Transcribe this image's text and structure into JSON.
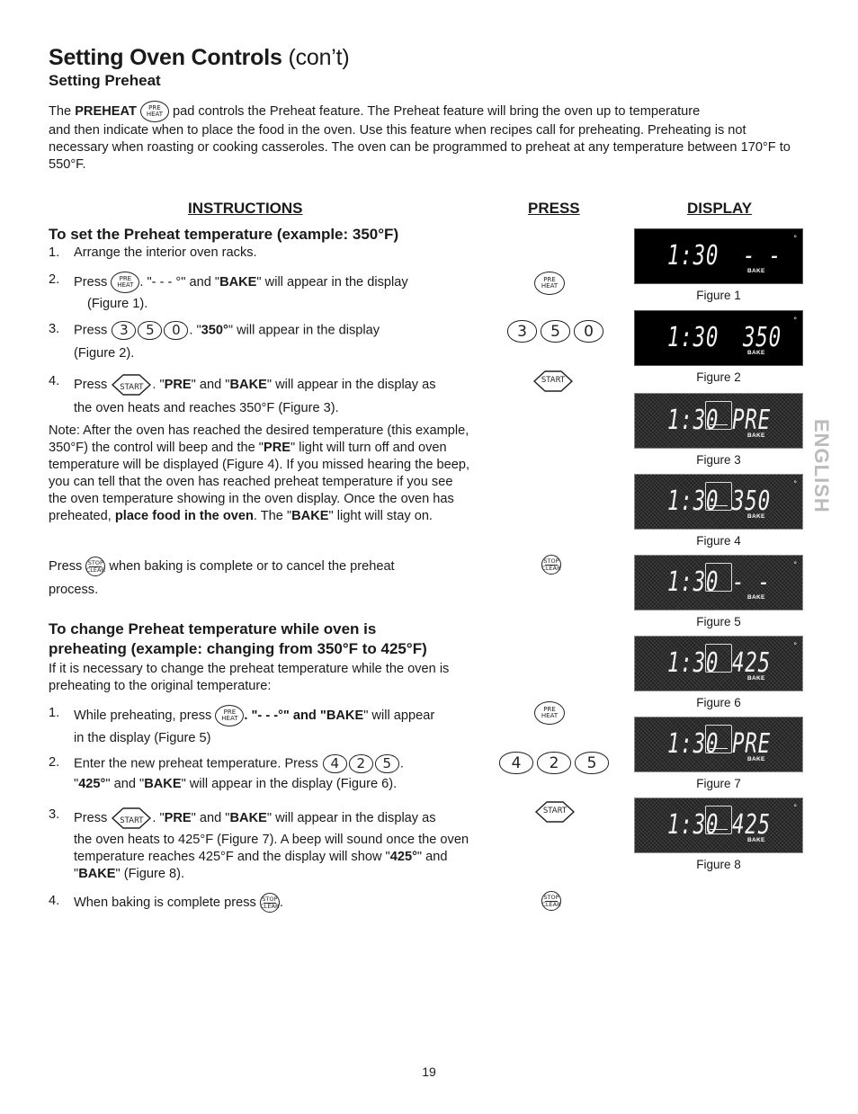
{
  "header": {
    "title_bold": "Setting Oven Controls",
    "title_normal": " (con’t)",
    "subtitle": "Setting Preheat"
  },
  "intro": {
    "pre_label": "The ",
    "pre_bold": "PREHEAT",
    "line1_rest": " pad controls the Preheat feature. The Preheat feature will bring the oven up to temperature",
    "line2": "and then indicate when to place the food in the oven. Use this feature when recipes call for preheating. Preheating is not necessary when roasting or cooking casseroles. The oven can be programmed to preheat at any temperature between 170°F to 550°F."
  },
  "columns": {
    "instructions": "INSTRUCTIONS",
    "press": "PRESS",
    "display": "DISPLAY"
  },
  "keys": {
    "preheat_top": "PRE",
    "preheat_bottom": "HEAT",
    "start": "START",
    "stop_top": "STOP",
    "stop_bottom": "CLEAR",
    "digits_set": [
      "3",
      "5",
      "0"
    ],
    "digits_change": [
      "4",
      "2",
      "5"
    ]
  },
  "section1": {
    "heading": "To set the Preheat temperature (example: 350°F)",
    "steps": [
      {
        "num": "1.",
        "text": "Arrange the interior oven racks."
      },
      {
        "num": "2.",
        "pre": "Press ",
        "mid": ". \"- - - °\" and \"",
        "bold": "BAKE",
        "post": "\" will appear in the display",
        "cont": "(Figure 1)."
      },
      {
        "num": "3.",
        "pre": "Press ",
        "mid": ". \"",
        "bold": "350°",
        "post": "\" will appear in the display",
        "cont": "(Figure 2)."
      },
      {
        "num": "4.",
        "pre": "Press ",
        "mid": ". \"",
        "bold": "PRE",
        "mid2": "\" and \"",
        "bold2": "BAKE",
        "post": "\" will appear in the display as",
        "cont": "the oven heats and reaches 350°F (Figure 3)."
      }
    ],
    "note_a": "Note: After the oven has reached the desired temperature (this example, 350°F) the control will beep and the \"",
    "note_bold1": "PRE",
    "note_b": "\" light will turn off and oven temperature will be displayed (Figure 4).  If you missed hearing the beep, you can tell that the oven has reached preheat temperature if you see the oven temperature showing in the oven display. Once the oven has preheated, ",
    "note_bold2": "place food in the oven",
    "note_c": ". The \"",
    "note_bold3": "BAKE",
    "note_d": "\" light will stay on.",
    "stop_pre": "Press ",
    "stop_post": " when baking is complete or to cancel the preheat",
    "stop_cont": "process."
  },
  "section2": {
    "heading_line1": "To change Preheat temperature while oven is",
    "heading_line2": "preheating (example: changing from 350°F to 425°F)",
    "intro": "If it is necessary to change the preheat temperature while the oven is preheating to the original temperature:",
    "steps": [
      {
        "num": "1.",
        "pre": "While preheating, press ",
        "mid": ". \"- - -°\" and \"",
        "bold": "BAKE",
        "post": "\" will appear",
        "cont": "in the display (Figure 5)"
      },
      {
        "num": "2.",
        "pre": "Enter the new preheat temperature. Press ",
        "post": ".",
        "cont_q": "\"",
        "cont_bold": "425°",
        "cont_mid": "\" and \"",
        "cont_bold2": "BAKE",
        "cont_post": "\"  will appear in the display (Figure 6)."
      },
      {
        "num": "3.",
        "pre": "Press ",
        "mid": ". \"",
        "bold": "PRE",
        "mid2": "\" and \"",
        "bold2": "BAKE",
        "post": "\" will appear in the display as",
        "cont_a": "the oven heats to 425°F (Figure 7). A beep will sound once the oven temperature reaches 425°F and  the display will show \"",
        "cont_bold": "425°",
        "cont_mid": "\" and \"",
        "cont_bold2": "BAKE",
        "cont_post": "\" (Figure 8)."
      },
      {
        "num": "4.",
        "pre": "When baking is complete press ",
        "post": "."
      }
    ]
  },
  "displays": [
    {
      "caption": "Figure 1",
      "time": "1:30",
      "temp": "- - -",
      "bake": "BAKE",
      "degree": "°",
      "style": "black",
      "indicator": "none"
    },
    {
      "caption": "Figure 2",
      "time": "1:30",
      "temp": "350",
      "bake": "BAKE",
      "degree": "°",
      "style": "black",
      "indicator": "none"
    },
    {
      "caption": "Figure 3",
      "time": "1:30",
      "temp": "PRE",
      "bake": "BAKE",
      "degree": "",
      "style": "gray",
      "indicator": "underline"
    },
    {
      "caption": "Figure 4",
      "time": "1:30",
      "temp": "350",
      "bake": "BAKE",
      "degree": "°",
      "style": "gray",
      "indicator": "underline"
    },
    {
      "caption": "Figure 5",
      "time": "1:30",
      "temp": "- - -",
      "bake": "BAKE",
      "degree": "°",
      "style": "gray",
      "indicator": "box"
    },
    {
      "caption": "Figure 6",
      "time": "1:30",
      "temp": "425",
      "bake": "BAKE",
      "degree": "°",
      "style": "gray",
      "indicator": "box"
    },
    {
      "caption": "Figure 7",
      "time": "1:30",
      "temp": "PRE",
      "bake": "BAKE",
      "degree": "",
      "style": "gray",
      "indicator": "underline"
    },
    {
      "caption": "Figure 8",
      "time": "1:30",
      "temp": "425",
      "bake": "BAKE",
      "degree": "°",
      "style": "gray",
      "indicator": "underline"
    }
  ],
  "side_label": "ENGLISH",
  "page_number": "19"
}
